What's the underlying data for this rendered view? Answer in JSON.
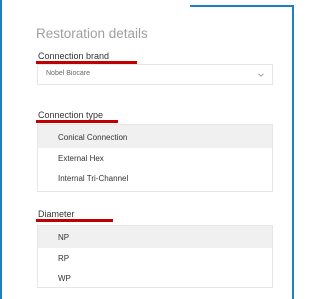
{
  "panel": {
    "title": "Restoration details"
  },
  "connection_brand": {
    "label": "Connection brand",
    "value": "Nobel Biocare",
    "chevron_icon": "chevron-down-icon"
  },
  "connection_type": {
    "label": "Connection type",
    "options": [
      "Conical Connection",
      "External Hex",
      "Internal Tri-Channel"
    ],
    "selected": "Conical Connection"
  },
  "diameter": {
    "label": "Diameter",
    "options": [
      "NP",
      "RP",
      "WP"
    ],
    "selected": "NP"
  },
  "colors": {
    "accent_frame": "#1f7fbf",
    "annotation_underline": "#c00000",
    "selected_row": "#f0f0f0"
  }
}
